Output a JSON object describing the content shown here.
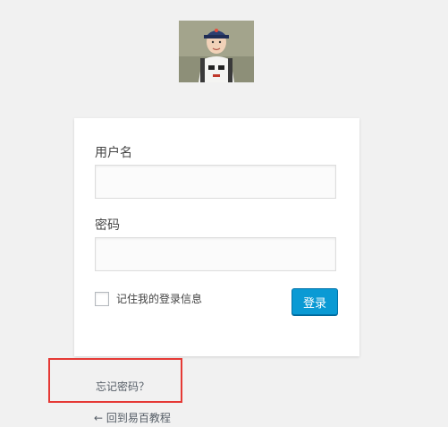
{
  "logo": {
    "icon": "child-photo-avatar"
  },
  "form": {
    "username_label": "用户名",
    "username_value": "",
    "password_label": "密码",
    "password_value": "",
    "remember_label": "记住我的登录信息",
    "submit_label": "登录"
  },
  "links": {
    "lost_password": "忘记密码？",
    "back_to_site": "← 回到易百教程"
  },
  "colors": {
    "background": "#f1f1f1",
    "button": "#0a9ad4",
    "highlight_box": "#e53935"
  }
}
